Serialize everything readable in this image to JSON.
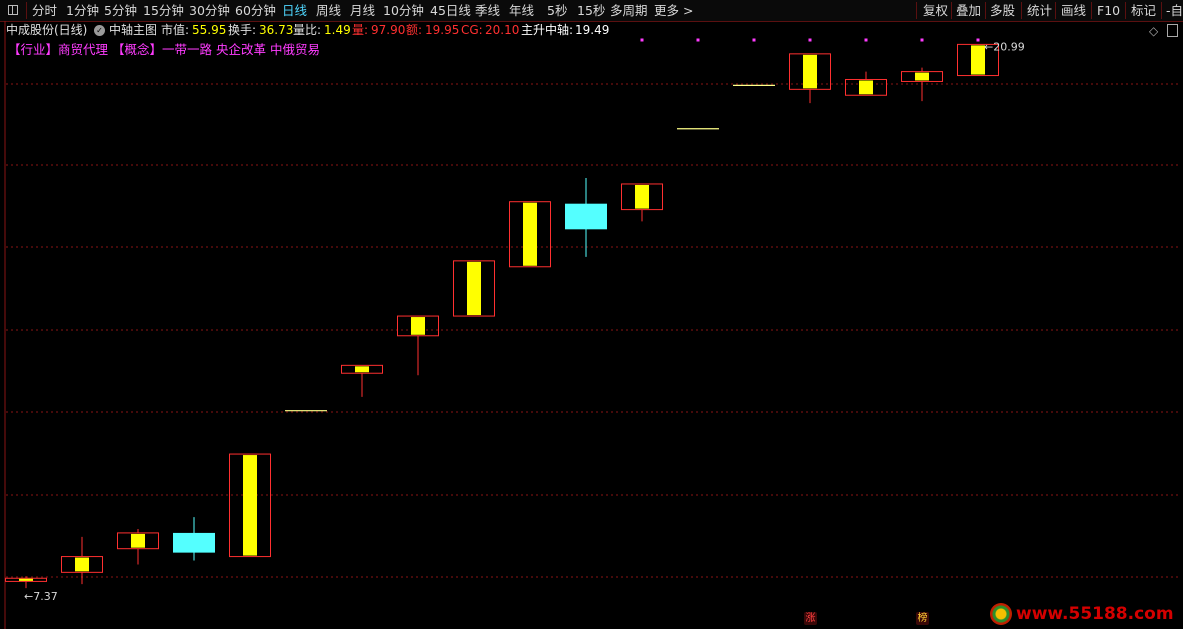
{
  "toolbar": {
    "periods": [
      "分时",
      "1分钟",
      "5分钟",
      "15分钟",
      "30分钟",
      "60分钟",
      "日线",
      "周线",
      "月线",
      "10分钟",
      "45日线",
      "季线",
      "年线",
      "5秒",
      "15秒",
      "多周期",
      "更多 >"
    ],
    "active_period": "日线",
    "right_buttons": [
      "复权",
      "叠加",
      "多股",
      "统计",
      "画线",
      "F10",
      "标记",
      "-自选"
    ]
  },
  "info": {
    "stock": "中成股份(日线)",
    "indicator": "中轴主图",
    "mcap_label": "市值:",
    "mcap_value": "55.95",
    "turnover_label": "换手:",
    "turnover_value": "36.73",
    "volratio_label": "量比:",
    "volratio_value": "1.49",
    "vol_label": "量:",
    "vol_value": "97.90",
    "amount_label": "额:",
    "amount_value": "19.95",
    "cg_label": "CG:",
    "cg_value": "20.10",
    "axis_label": "主升中轴:",
    "axis_value": "19.49"
  },
  "concepts": [
    "【行业】商贸代理",
    "【概念】一带一路",
    "央企改革",
    "中俄贸易"
  ],
  "colors": {
    "up_border": "#ff3030",
    "up_fill": "#ffff00",
    "down_fill": "#54ffff",
    "grid": "#8a1515",
    "magenta": "#ff3cff",
    "active_tab": "#4fd7ff"
  },
  "chart_data": {
    "type": "candlestick",
    "title": "中成股份(日线)",
    "candles": [
      {
        "open": 7.37,
        "high": 7.5,
        "low": 7.2,
        "close": 7.45
      },
      {
        "open": 7.6,
        "high": 8.5,
        "low": 7.3,
        "close": 8.0
      },
      {
        "open": 8.2,
        "high": 8.7,
        "low": 7.8,
        "close": 8.6
      },
      {
        "open": 8.6,
        "high": 9.0,
        "low": 7.9,
        "close": 8.1
      },
      {
        "open": 8.0,
        "high": 10.6,
        "low": 8.0,
        "close": 10.6
      },
      {
        "open": 11.7,
        "high": 11.7,
        "low": 11.7,
        "close": 11.7
      },
      {
        "open": 12.65,
        "high": 12.85,
        "low": 12.05,
        "close": 12.85
      },
      {
        "open": 13.6,
        "high": 14.1,
        "low": 12.6,
        "close": 14.1
      },
      {
        "open": 14.1,
        "high": 15.5,
        "low": 14.1,
        "close": 15.5
      },
      {
        "open": 15.35,
        "high": 17.0,
        "low": 15.35,
        "close": 17.0
      },
      {
        "open": 16.95,
        "high": 17.6,
        "low": 15.6,
        "close": 16.3
      },
      {
        "open": 16.8,
        "high": 17.45,
        "low": 16.5,
        "close": 17.45
      },
      {
        "open": 18.85,
        "high": 18.85,
        "low": 18.85,
        "close": 18.85
      },
      {
        "open": 19.95,
        "high": 19.95,
        "low": 19.95,
        "close": 19.95
      },
      {
        "open": 19.85,
        "high": 20.75,
        "low": 19.5,
        "close": 20.75
      },
      {
        "open": 19.7,
        "high": 20.3,
        "low": 19.7,
        "close": 20.1
      },
      {
        "open": 20.05,
        "high": 20.4,
        "low": 19.55,
        "close": 20.3
      },
      {
        "open": 20.2,
        "high": 20.99,
        "low": 20.2,
        "close": 20.99
      }
    ],
    "y_range": [
      7.0,
      21.0
    ],
    "grid": true,
    "min_label": "7.37",
    "max_label": "20.99",
    "markers": [
      {
        "candle": 14,
        "text": "涨",
        "color": "#ff4040"
      },
      {
        "candle": 16,
        "text": "榜",
        "color": "#ffcc33"
      }
    ],
    "top_dots": [
      11,
      12,
      13,
      14,
      15,
      16,
      17
    ]
  },
  "watermark": "www.55188.com"
}
